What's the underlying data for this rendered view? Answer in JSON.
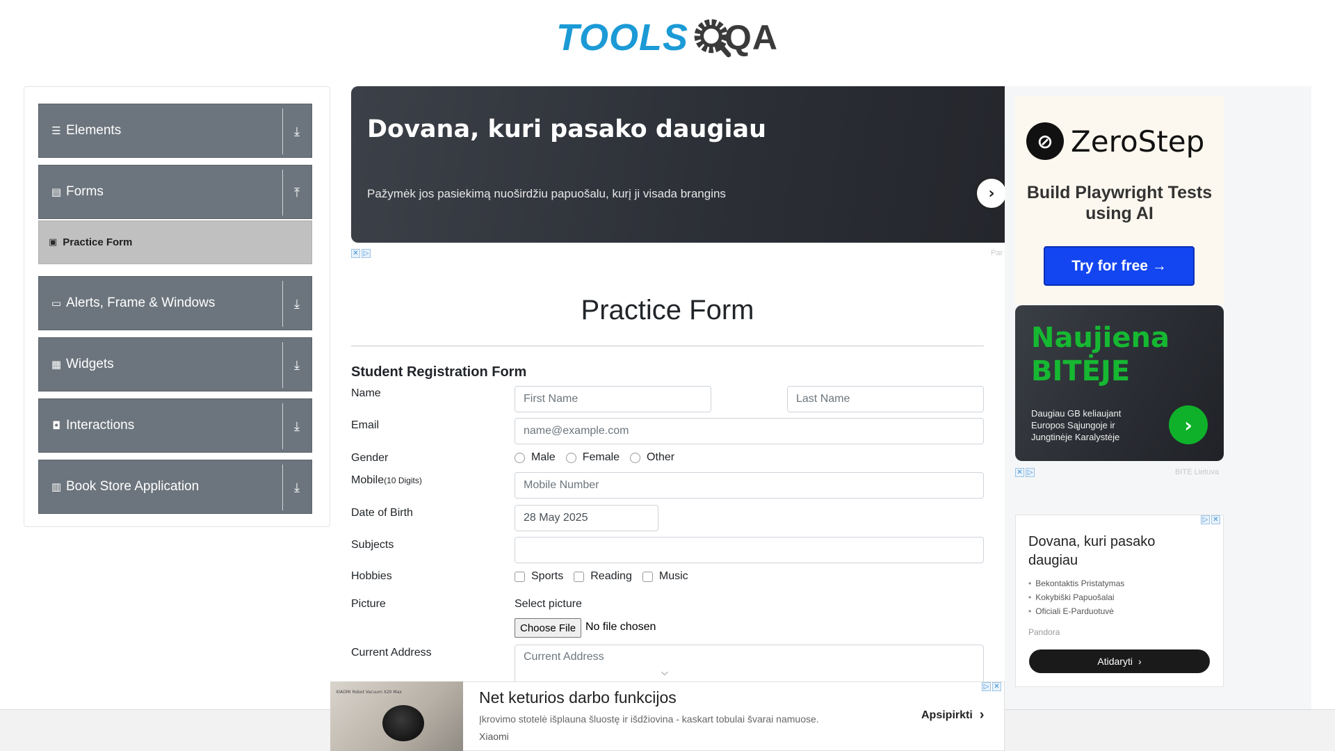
{
  "header": {
    "logo_tools": "TOOLS",
    "logo_qa": "QA"
  },
  "sidebar": {
    "groups": [
      {
        "label": "Elements",
        "icon": "menu-icon",
        "expanded": false
      },
      {
        "label": "Forms",
        "icon": "document-icon",
        "expanded": true
      },
      {
        "label": "Alerts, Frame & Windows",
        "icon": "window-icon",
        "expanded": false
      },
      {
        "label": "Widgets",
        "icon": "grid-icon",
        "expanded": false
      },
      {
        "label": "Interactions",
        "icon": "interactions-icon",
        "expanded": false
      },
      {
        "label": "Book Store Application",
        "icon": "books-icon",
        "expanded": false
      }
    ],
    "active_item": {
      "label": "Practice Form",
      "icon": "form-icon"
    }
  },
  "top_ad": {
    "title": "Dovana, kuri pasako daugiau",
    "subtitle": "Pažymėk jos pasiekimą nuoširdžiu papuošalu, kurį ji visada brangins",
    "credit": "Par"
  },
  "form": {
    "page_title": "Practice Form",
    "section_title": "Student Registration Form",
    "labels": {
      "name": "Name",
      "email": "Email",
      "gender": "Gender",
      "mobile": "Mobile",
      "mobile_hint": "(10 Digits)",
      "dob": "Date of Birth",
      "subjects": "Subjects",
      "hobbies": "Hobbies",
      "picture": "Picture",
      "address": "Current Address"
    },
    "placeholders": {
      "first_name": "First Name",
      "last_name": "Last Name",
      "email": "name@example.com",
      "mobile": "Mobile Number",
      "address": "Current Address"
    },
    "dob_value": "28 May 2025",
    "genders": [
      "Male",
      "Female",
      "Other"
    ],
    "hobbies": [
      "Sports",
      "Reading",
      "Music"
    ],
    "picture_label": "Select picture",
    "file_button": "Choose File",
    "file_status": "No file chosen"
  },
  "right_ads": {
    "zerostep": {
      "name": "ZeroStep",
      "tagline": "Build Playwright Tests using AI",
      "button": "Try for free →"
    },
    "bite": {
      "headline_1": "Naujiena",
      "headline_2": "BITĖJE",
      "text": "Daugiau GB keliaujant Europos Sąjungoje ir Jungtinėje Karalystėje",
      "credit": "BITĖ Lietuva"
    },
    "pandora": {
      "title": "Dovana, kuri pasako daugiau",
      "bullets": [
        "Bekontaktis Pristatymas",
        "Kokybiški Papuošalai",
        "Oficiali E-Parduotuvė"
      ],
      "brand": "Pandora",
      "button": "Atidaryti"
    }
  },
  "bottom_ad": {
    "title": "Net keturios darbo funkcijos",
    "subtitle": "Įkrovimo stotelė išplauna šluostę ir išdžiovina - kaskart tobulai švarai namuose.",
    "brand": "Xiaomi",
    "cta": "Apsipirkti",
    "image_caption": "XIAOMI Robot Vacuum X20 Max"
  },
  "colors": {
    "sidebar_group_bg": "#6c757d",
    "sidebar_active_bg": "#c0c0c0",
    "brand_blue": "#1b9ad6",
    "zerostep_button": "#1346f0",
    "bite_green": "#16b832"
  }
}
